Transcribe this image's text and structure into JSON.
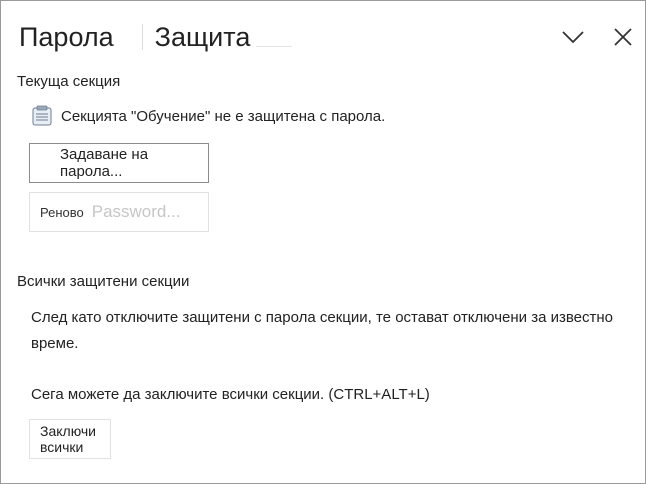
{
  "header": {
    "tabs": [
      {
        "label": "Парола"
      },
      {
        "label": "Защита"
      }
    ]
  },
  "current_section": {
    "title": "Текуща секция",
    "status": "Секцията \"Обучение\" не е защитена с парола.",
    "set_password_button": "Задаване на парола...",
    "change_password_button": {
      "label1": "Реново",
      "label2": "Password..."
    }
  },
  "all_sections": {
    "title": "Всички защитени секции",
    "description_line1": "След като отключите защитени с парола секции, те остават отключени за известно",
    "description_line2": "време.",
    "lock_hint": "Сега можете да заключите всички секции. (CTRL+ALT+L)",
    "lock_all_button": "Заключи всички"
  },
  "icons": {
    "collapse": "chevron-down-icon",
    "close": "close-icon",
    "section": "section-page-icon"
  },
  "colors": {
    "border": "#9a9a9a",
    "text": "#222222",
    "disabled_text": "#c6c6c6"
  }
}
